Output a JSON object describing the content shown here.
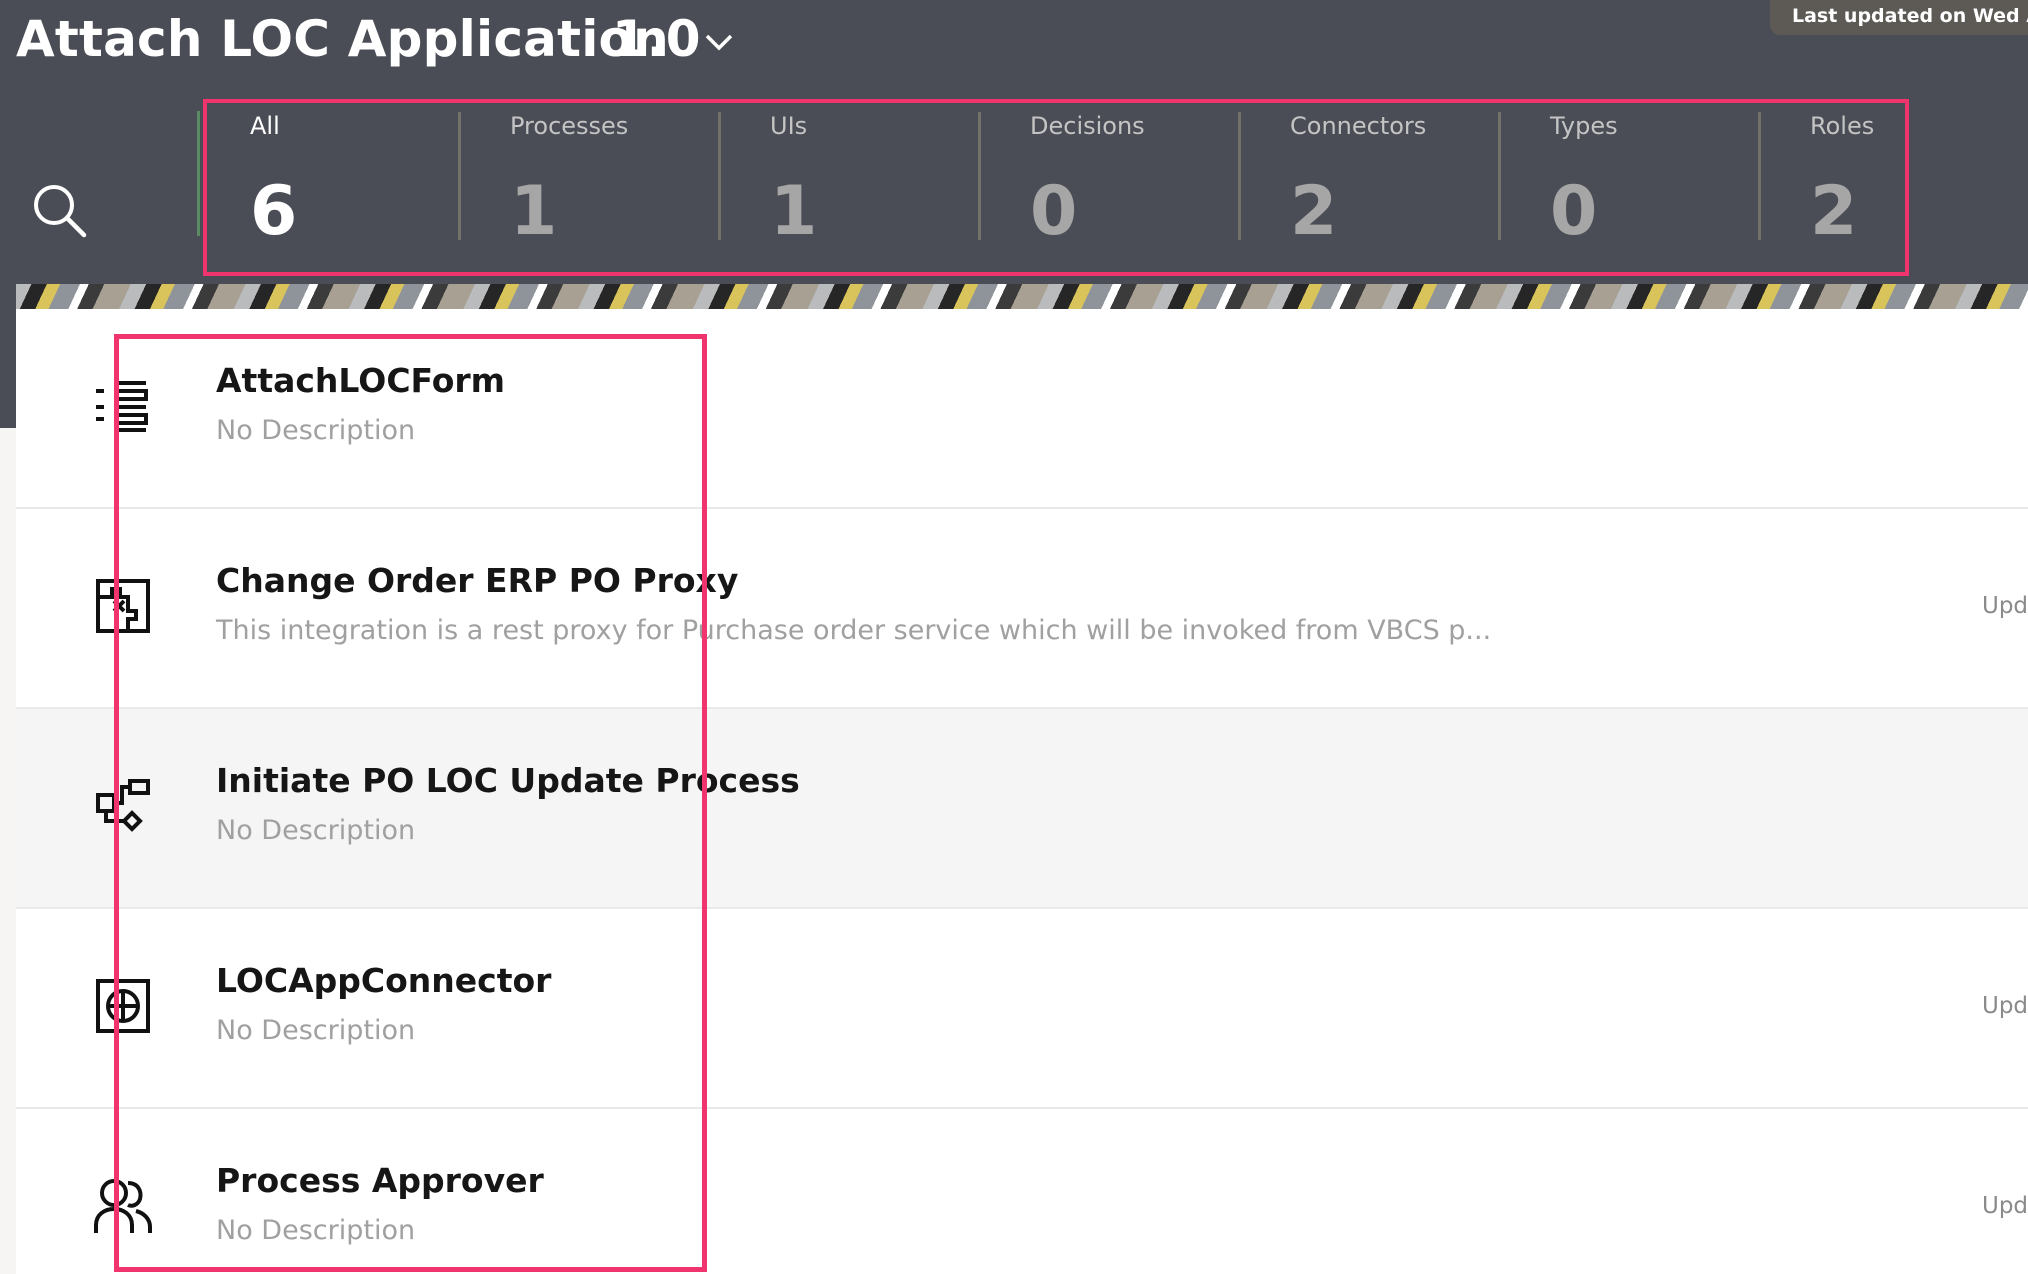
{
  "header": {
    "app_title": "Attach LOC Application",
    "version": "1.0",
    "last_updated": "Last updated on Wed Aug"
  },
  "stats": [
    {
      "label": "All",
      "value": "6",
      "active": true
    },
    {
      "label": "Processes",
      "value": "1"
    },
    {
      "label": "UIs",
      "value": "1"
    },
    {
      "label": "Decisions",
      "value": "0"
    },
    {
      "label": "Connectors",
      "value": "2"
    },
    {
      "label": "Types",
      "value": "0"
    },
    {
      "label": "Roles",
      "value": "2"
    }
  ],
  "items": [
    {
      "name": "AttachLOCForm",
      "description": "No Description",
      "icon": "form-icon",
      "updated": ""
    },
    {
      "name": "Change Order ERP PO Proxy",
      "description": "This integration is a rest proxy for Purchase order service which will be invoked from VBCS p...",
      "icon": "integration-icon",
      "updated": "Upd"
    },
    {
      "name": "Initiate PO LOC Update Process",
      "description": "No Description",
      "icon": "process-icon",
      "updated": ""
    },
    {
      "name": "LOCAppConnector",
      "description": "No Description",
      "icon": "connector-icon",
      "updated": "Upd"
    },
    {
      "name": "Process Approver",
      "description": "No Description",
      "icon": "role-icon",
      "updated": "Upd"
    }
  ],
  "colors": {
    "header_bg": "#4a4d55",
    "highlight": "#f0346e",
    "divider_accent": "#5b8a63"
  }
}
